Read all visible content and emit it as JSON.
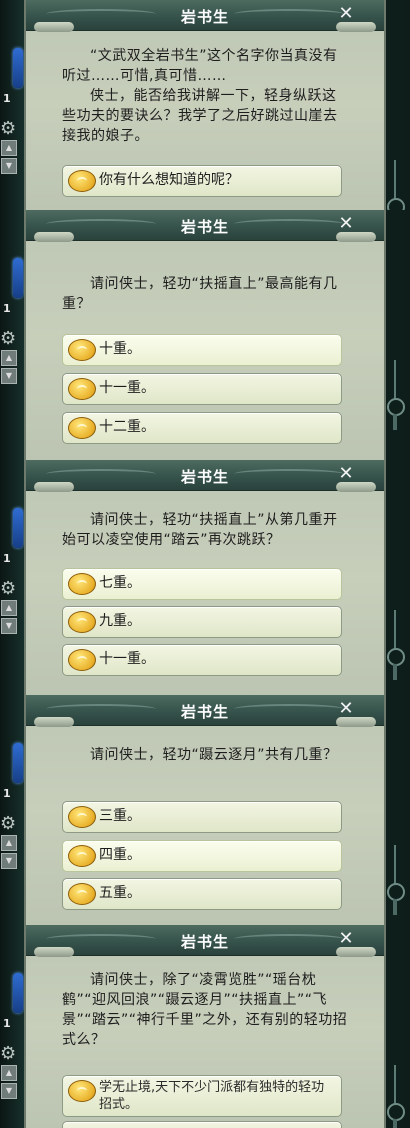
{
  "side": {
    "count": "1",
    "gear": "⚙",
    "up": "▲",
    "down": "▼"
  },
  "dialogs": [
    {
      "title": "岩书生",
      "close": "✕",
      "text": [
        "“文武双全岩书生”这个名字你当真没有听过……可惜,真可惜……",
        "侠士，能否给我讲解一下，轻身纵跃这些功夫的要诀么？我学了之后好跳过山崖去接我的娘子。"
      ],
      "options": [
        "你有什么想知道的呢？"
      ]
    },
    {
      "title": "岩书生",
      "close": "✕",
      "text": [
        "请问侠士，轻功“扶摇直上”最高能有几重？"
      ],
      "options": [
        "十重。",
        "十一重。",
        "十二重。"
      ]
    },
    {
      "title": "岩书生",
      "close": "✕",
      "text": [
        "请问侠士，轻功“扶摇直上”从第几重开始可以凌空使用“踏云”再次跳跃？"
      ],
      "options": [
        "七重。",
        "九重。",
        "十一重。"
      ]
    },
    {
      "title": "岩书生",
      "close": "✕",
      "text": [
        "请问侠士，轻功“蹑云逐月”共有几重？"
      ],
      "options": [
        "三重。",
        "四重。",
        "五重。"
      ]
    },
    {
      "title": "岩书生",
      "close": "✕",
      "text": [
        "请问侠士，除了“凌霄览胜”“瑶台枕鹤”“迎风回浪”“蹑云逐月”“扶摇直上”“飞景”“踏云”“神行千里”之外，还有别的轻功招式么？"
      ],
      "options": [
        "学无止境,天下不少门派都有独特的轻功招式。"
      ]
    }
  ]
}
